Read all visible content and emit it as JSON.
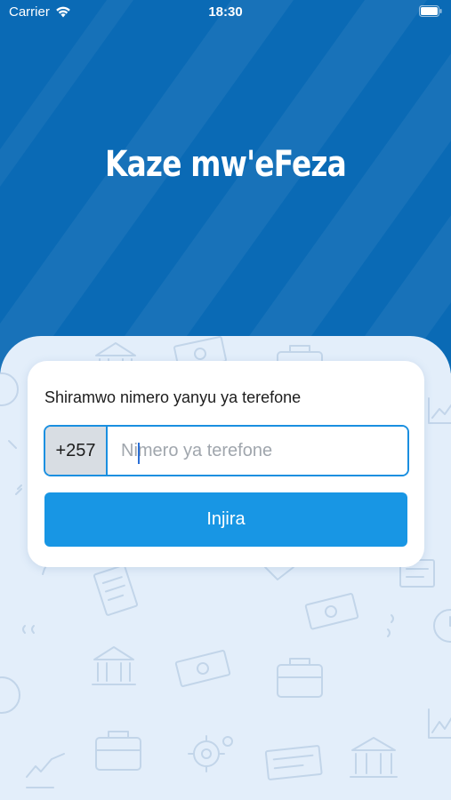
{
  "status_bar": {
    "carrier": "Carrier",
    "time": "18:30",
    "icons": [
      "wifi-icon",
      "battery-icon"
    ]
  },
  "header": {
    "title": "Kaze mw'eFeza",
    "background_color": "#0a6ab5"
  },
  "login_card": {
    "prompt": "Shiramwo nimero yanyu ya terefone",
    "country_code": "+257",
    "phone_input": {
      "value": "",
      "placeholder": "Nimero ya terefone"
    },
    "submit_label": "Injira",
    "accent_color": "#1896e4"
  },
  "background_pattern_icons": [
    "bank-icon",
    "banknote-icon",
    "briefcase-icon",
    "document-icon",
    "gear-icon",
    "clock-icon",
    "chart-icon",
    "pen-icon",
    "quote-icon"
  ]
}
